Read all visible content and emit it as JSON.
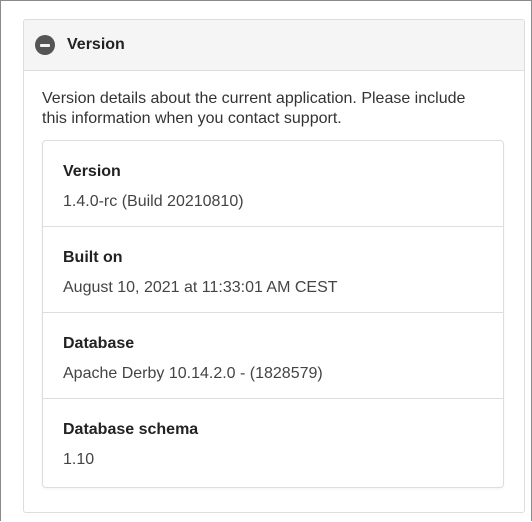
{
  "panel": {
    "title": "Version",
    "icon": "collapse-minus-icon",
    "description": "Version details about the current application. Please include this information when you contact support."
  },
  "details": [
    {
      "label": "Version",
      "value": "1.4.0-rc (Build 20210810)"
    },
    {
      "label": "Built on",
      "value": "August 10, 2021 at 11:33:01 AM CEST"
    },
    {
      "label": "Database",
      "value": "Apache Derby 10.14.2.0 - (1828579)"
    },
    {
      "label": "Database schema",
      "value": "1.10"
    }
  ]
}
